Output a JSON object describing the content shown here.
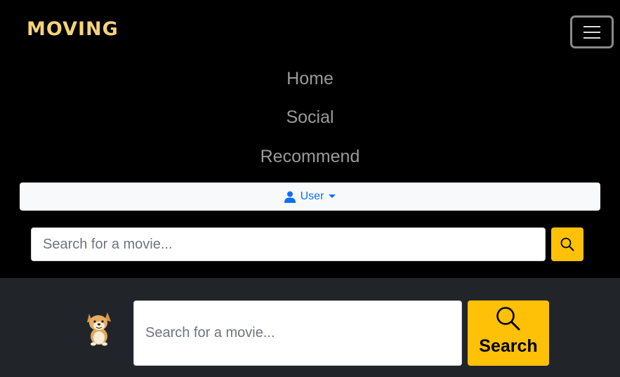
{
  "navbar": {
    "brand": "MOVING",
    "toggler_icon": "hamburger-menu-icon",
    "links": [
      {
        "label": "Home"
      },
      {
        "label": "Social"
      },
      {
        "label": "Recommend"
      }
    ],
    "user_menu": {
      "label": "User",
      "icon": "person-icon",
      "color": "#0d6efd"
    },
    "search": {
      "placeholder": "Search for a movie...",
      "button_icon": "search-icon"
    }
  },
  "hero": {
    "mascot_icon": "doge-dog-icon",
    "search": {
      "placeholder": "Search for a movie...",
      "button_label": "Search",
      "button_icon": "search-icon"
    }
  },
  "colors": {
    "accent": "#ffc107",
    "brand": "#f5d37a",
    "navbar_bg": "#000000",
    "hero_bg": "#212529",
    "link": "#9a9a9a"
  }
}
